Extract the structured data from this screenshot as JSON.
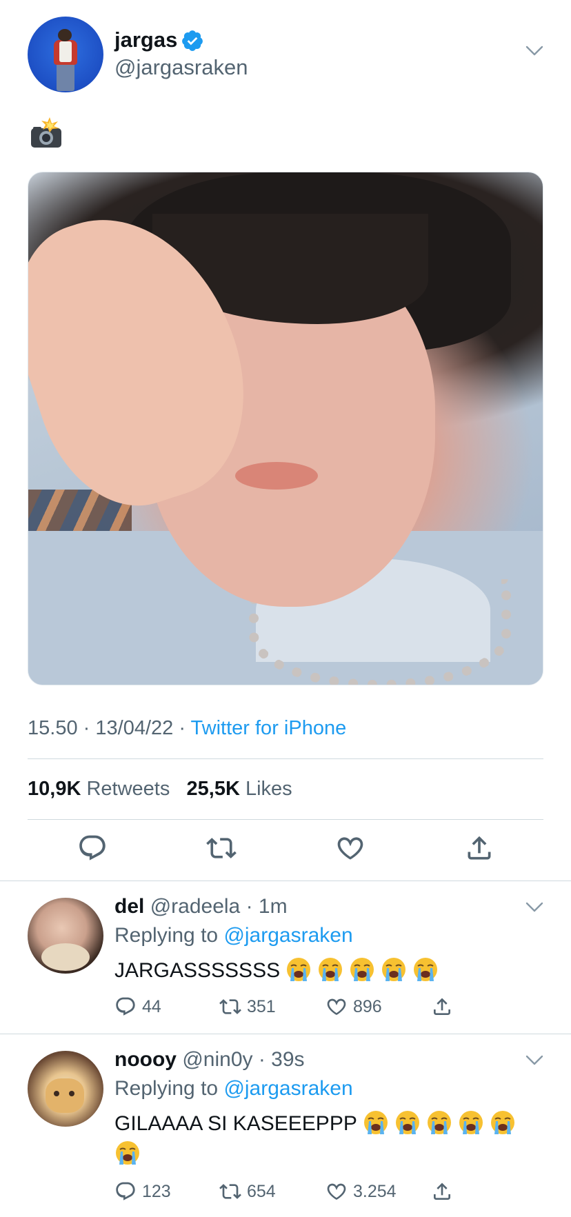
{
  "main_tweet": {
    "display_name": "jargas",
    "handle": "@jargasraken",
    "text_emoji": "📸",
    "time": "15.50",
    "date": "13/04/22",
    "separator": "·",
    "client": "Twitter for iPhone",
    "retweets_count": "10,9K",
    "retweets_label": "Retweets",
    "likes_count": "25,5K",
    "likes_label": "Likes"
  },
  "replies": [
    {
      "display_name": "del",
      "handle_time": "@radeela · 1m",
      "replying_label": "Replying to",
      "mention": "@jargasraken",
      "text": "JARGASSSSSSS",
      "emoji_count": 5,
      "replies_count": "44",
      "retweets_count": "351",
      "likes_count": "896"
    },
    {
      "display_name": "noooy",
      "handle_time": "@nin0y · 39s",
      "replying_label": "Replying to",
      "mention": "@jargasraken",
      "text": "GILAAAA SI KASEEEPPP",
      "emoji_count": 6,
      "replies_count": "123",
      "retweets_count": "654",
      "likes_count": "3.254"
    }
  ],
  "icons": {
    "verified": "verified-badge-icon",
    "menu": "chevron-down-icon",
    "reply": "reply-icon",
    "retweet": "retweet-icon",
    "like": "heart-icon",
    "share": "share-icon",
    "camera_flash": "camera-flash-emoji",
    "crying": "loudly-crying-emoji"
  },
  "colors": {
    "accent": "#1d9bf0",
    "text_primary": "#0f1419",
    "text_secondary": "#536471",
    "divider": "#cfd9de"
  }
}
